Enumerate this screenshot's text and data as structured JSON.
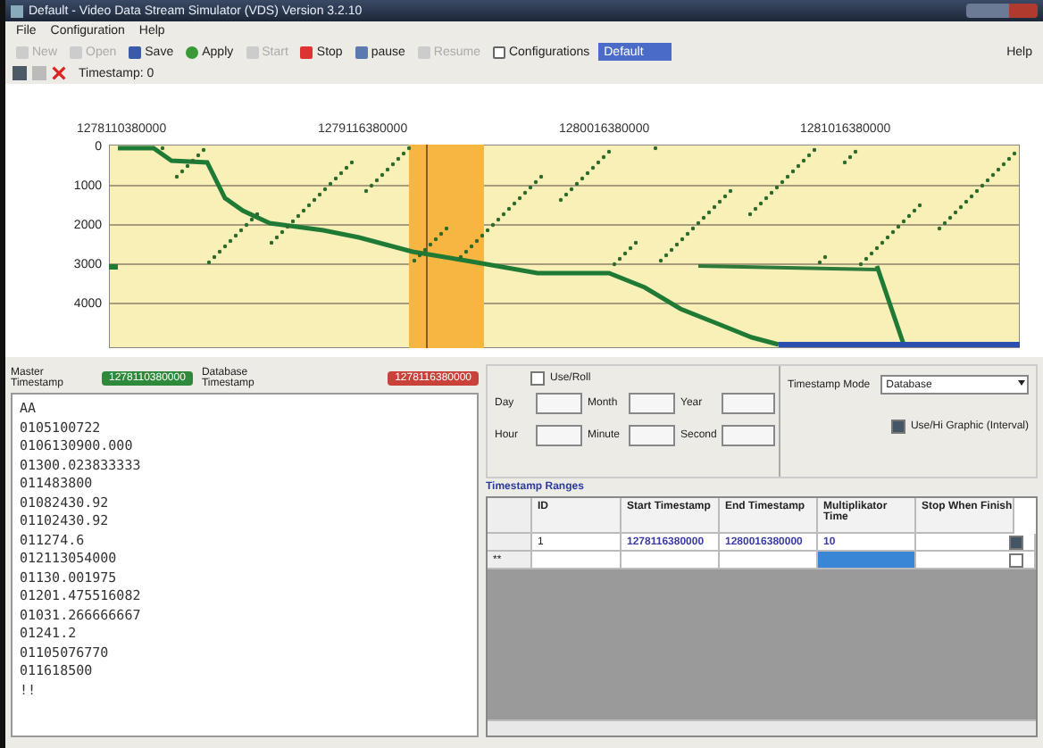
{
  "window": {
    "title": "Default - Video Data Stream Simulator (VDS) Version 3.2.10"
  },
  "menu": [
    "File",
    "Configuration",
    "Help"
  ],
  "toolbar": [
    {
      "label": "New",
      "disabled": true
    },
    {
      "label": "Open",
      "disabled": true
    },
    {
      "label": "Save",
      "disabled": false
    },
    {
      "label": "Apply",
      "disabled": false
    },
    {
      "label": "Start",
      "disabled": true
    },
    {
      "label": "Stop",
      "disabled": false
    },
    {
      "label": "pause",
      "disabled": false
    },
    {
      "label": "Resume",
      "disabled": true
    },
    {
      "label": "Configurations",
      "disabled": false
    }
  ],
  "configuration_combo": {
    "value": "Default"
  },
  "help_button": "Help",
  "timestamp_label": "Timestamp: 0",
  "chart": {
    "x_tick_labels": [
      "1278110380000",
      "1279116380000",
      "1280016380000",
      "1281016380000"
    ],
    "y_tick_labels": [
      "0",
      "1000",
      "2000",
      "3000",
      "4000"
    ]
  },
  "master": {
    "label": "Master Timestamp",
    "value": "1278110380000",
    "db_label": "Database Timestamp",
    "db_value": "1278116380000"
  },
  "log_lines": [
    "AA",
    "0105100722",
    "0106130900.000",
    "01300.023833333",
    "011483800",
    "01082430.92",
    "01102430.92",
    "011274.6",
    "012113054000",
    "01130.001975",
    "01201.475516082",
    "01031.266666667",
    "01241.2",
    "01105076770",
    "011618500",
    "!!"
  ],
  "date_panel": {
    "use_roll": {
      "label": "Use/Roll",
      "checked": false
    },
    "fields": [
      {
        "label": "Day"
      },
      {
        "label": "Month"
      },
      {
        "label": "Year"
      },
      {
        "label": "Hour"
      },
      {
        "label": "Minute"
      },
      {
        "label": "Second"
      }
    ]
  },
  "mode": {
    "label": "Timestamp Mode",
    "value": "Database",
    "option": {
      "label": "Use/Hi Graphic (Interval)",
      "checked": true
    }
  },
  "ranges": {
    "title": "Timestamp Ranges",
    "columns": [
      "ID",
      "Start Timestamp",
      "End Timestamp",
      "Multiplikator Time",
      "Stop When Finish"
    ],
    "rows": [
      {
        "marker": "",
        "id": "1",
        "start": "1278116380000",
        "end": "1280016380000",
        "multiplier": "10",
        "stop": true,
        "selected": false
      },
      {
        "marker": "**",
        "id": "",
        "start": "",
        "end": "",
        "multiplier": "",
        "stop": false,
        "selected": true
      }
    ]
  }
}
